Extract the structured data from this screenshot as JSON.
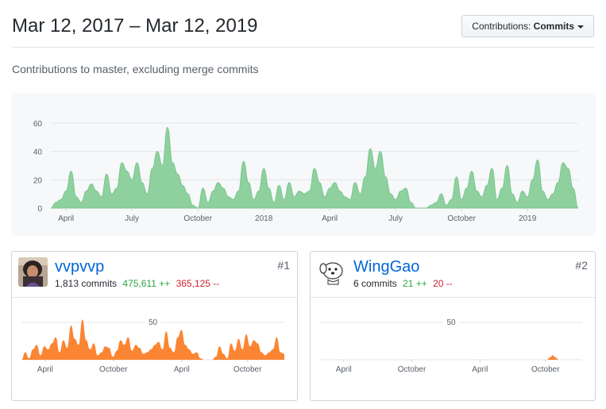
{
  "header": {
    "date_range": "Mar 12, 2017 – Mar 12, 2019",
    "contributions_button": {
      "prefix": "Contributions: ",
      "value": "Commits"
    }
  },
  "subtitle": "Contributions to master, excluding merge commits",
  "colors": {
    "main_area": "#8fd19e",
    "main_line": "#7ac58e",
    "user_area": "#fb8532",
    "link": "#0366d6",
    "additions": "#28a745",
    "deletions": "#cb2431"
  },
  "chart_data": [
    {
      "type": "area",
      "title": "",
      "ylim": [
        0,
        60
      ],
      "yticks": [
        0,
        20,
        40,
        60
      ],
      "x_tick_labels": [
        "April",
        "July",
        "October",
        "2018",
        "April",
        "July",
        "October",
        "2019"
      ],
      "x": [
        "2017-03-12",
        "2017-03-19",
        "2017-03-26",
        "2017-04-02",
        "2017-04-09",
        "2017-04-16",
        "2017-04-23",
        "2017-04-30",
        "2017-05-07",
        "2017-05-14",
        "2017-05-21",
        "2017-05-28",
        "2017-06-04",
        "2017-06-11",
        "2017-06-18",
        "2017-06-25",
        "2017-07-02",
        "2017-07-09",
        "2017-07-16",
        "2017-07-23",
        "2017-07-30",
        "2017-08-06",
        "2017-08-13",
        "2017-08-20",
        "2017-08-27",
        "2017-09-03",
        "2017-09-10",
        "2017-09-17",
        "2017-09-24",
        "2017-10-01",
        "2017-10-08",
        "2017-10-15",
        "2017-10-22",
        "2017-10-29",
        "2017-11-05",
        "2017-11-12",
        "2017-11-19",
        "2017-11-26",
        "2017-12-03",
        "2017-12-10",
        "2017-12-17",
        "2017-12-24",
        "2017-12-31",
        "2018-01-07",
        "2018-01-14",
        "2018-01-21",
        "2018-01-28",
        "2018-02-04",
        "2018-02-11",
        "2018-02-18",
        "2018-02-25",
        "2018-03-04",
        "2018-03-11",
        "2018-03-18",
        "2018-03-25",
        "2018-04-01",
        "2018-04-08",
        "2018-04-15",
        "2018-04-22",
        "2018-04-29",
        "2018-05-06",
        "2018-05-13",
        "2018-05-20",
        "2018-05-27",
        "2018-06-03",
        "2018-06-10",
        "2018-06-17",
        "2018-06-24",
        "2018-07-01",
        "2018-07-08",
        "2018-07-15",
        "2018-07-22",
        "2018-07-29",
        "2018-08-05",
        "2018-08-12",
        "2018-08-19",
        "2018-08-26",
        "2018-09-02",
        "2018-09-09",
        "2018-09-16",
        "2018-09-23",
        "2018-09-30",
        "2018-10-07",
        "2018-10-14",
        "2018-10-21",
        "2018-10-28",
        "2018-11-04",
        "2018-11-11",
        "2018-11-18",
        "2018-11-25",
        "2018-12-02",
        "2018-12-09",
        "2018-12-16",
        "2018-12-23",
        "2018-12-30",
        "2019-01-06",
        "2019-01-13",
        "2019-01-20",
        "2019-01-27",
        "2019-02-03",
        "2019-02-10",
        "2019-02-17",
        "2019-02-24",
        "2019-03-03",
        "2019-03-10"
      ],
      "series": [
        {
          "values": [
            0,
            4,
            6,
            12,
            26,
            8,
            4,
            12,
            17,
            12,
            8,
            24,
            10,
            14,
            32,
            26,
            20,
            32,
            18,
            10,
            28,
            40,
            30,
            57,
            32,
            24,
            16,
            10,
            2,
            0,
            14,
            4,
            12,
            18,
            14,
            8,
            6,
            12,
            33,
            18,
            6,
            12,
            28,
            14,
            4,
            16,
            6,
            18,
            8,
            12,
            10,
            12,
            28,
            18,
            8,
            14,
            18,
            12,
            8,
            6,
            18,
            10,
            22,
            42,
            28,
            40,
            22,
            10,
            6,
            12,
            14,
            4,
            0,
            0,
            0,
            2,
            4,
            10,
            2,
            6,
            22,
            6,
            14,
            26,
            12,
            8,
            16,
            28,
            6,
            14,
            30,
            10,
            4,
            12,
            8,
            20,
            34,
            12,
            6,
            10,
            18,
            32,
            28,
            14,
            0
          ]
        }
      ]
    },
    {
      "type": "area",
      "title": "vvpvvp",
      "x_tick_labels": [
        "April",
        "October",
        "April",
        "October"
      ],
      "y_gridline_label": "50",
      "series": [
        {
          "name": "vvpvvp",
          "values": [
            0,
            10,
            2,
            14,
            20,
            6,
            18,
            14,
            22,
            30,
            10,
            26,
            16,
            46,
            28,
            20,
            54,
            26,
            14,
            22,
            6,
            10,
            18,
            16,
            4,
            12,
            26,
            20,
            30,
            12,
            20,
            16,
            8,
            10,
            14,
            20,
            24,
            14,
            38,
            16,
            10,
            30,
            40,
            20,
            14,
            8,
            10,
            2,
            0,
            0,
            0,
            4,
            18,
            8,
            2,
            22,
            12,
            28,
            14,
            34,
            18,
            26,
            22,
            10,
            6,
            10,
            14,
            30,
            10,
            8
          ]
        }
      ]
    },
    {
      "type": "area",
      "title": "WingGao",
      "x_tick_labels": [
        "April",
        "October",
        "April",
        "October"
      ],
      "y_gridline_label": "50",
      "series": [
        {
          "name": "WingGao",
          "values": [
            0,
            0,
            0,
            0,
            0,
            0,
            0,
            0,
            0,
            0,
            0,
            0,
            0,
            0,
            0,
            0,
            0,
            0,
            0,
            0,
            0,
            0,
            0,
            0,
            0,
            0,
            0,
            0,
            0,
            0,
            0,
            0,
            0,
            0,
            0,
            0,
            0,
            0,
            0,
            0,
            0,
            0,
            0,
            0,
            0,
            0,
            0,
            0,
            0,
            0,
            0,
            0,
            0,
            0,
            0,
            0,
            0,
            0,
            0,
            0,
            0,
            0,
            0,
            0,
            0,
            0,
            0,
            0,
            0,
            0,
            0,
            0,
            0,
            0,
            0,
            0,
            0,
            0,
            3,
            6,
            3,
            0,
            0,
            0,
            0,
            0,
            0,
            0,
            0,
            0
          ]
        }
      ]
    }
  ],
  "contributors": [
    {
      "username": "vvpvvp",
      "commits": "1,813 commits",
      "additions": "475,611 ++",
      "deletions": "365,125 --",
      "rank": "#1",
      "avatar_icon": "user-photo-icon"
    },
    {
      "username": "WingGao",
      "commits": "6 commits",
      "additions": "21 ++",
      "deletions": "20 --",
      "rank": "#2",
      "avatar_icon": "cartoon-dog-icon"
    }
  ]
}
